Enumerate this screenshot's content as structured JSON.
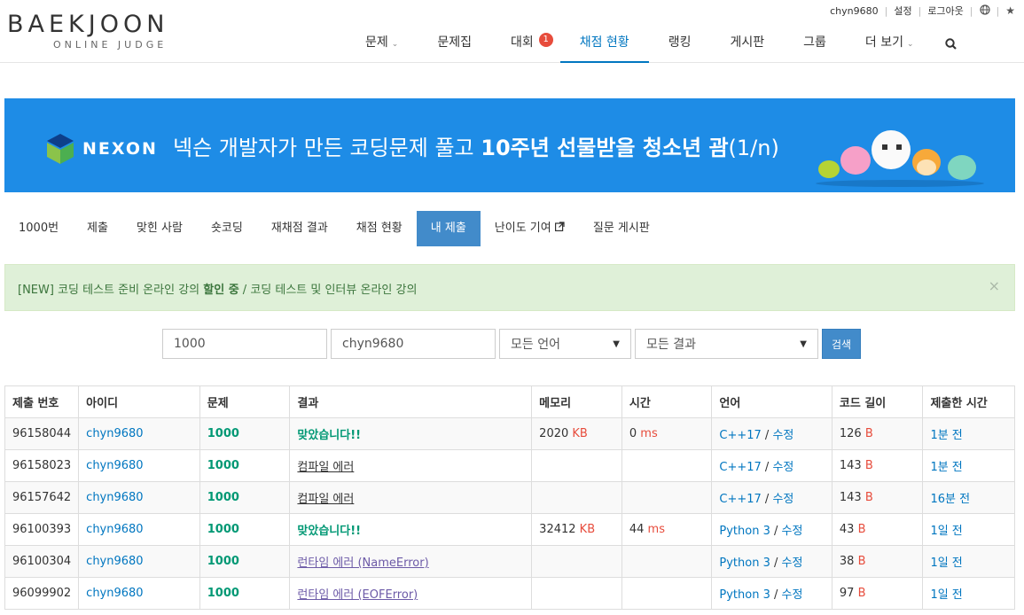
{
  "header": {
    "logo_main": "BAEKJOON",
    "logo_sub": "ONLINE JUDGE",
    "user": "chyn9680",
    "settings": "설정",
    "logout": "로그아웃",
    "nav": [
      {
        "label": "문제",
        "caret": true
      },
      {
        "label": "문제집"
      },
      {
        "label": "대회",
        "badge": "1"
      },
      {
        "label": "채점 현황",
        "active": true
      },
      {
        "label": "랭킹"
      },
      {
        "label": "게시판"
      },
      {
        "label": "그룹"
      },
      {
        "label": "더 보기",
        "caret": true
      }
    ]
  },
  "banner": {
    "brand": "NEXON",
    "text_prefix": "넥슨 개발자가 만든 코딩문제 풀고 ",
    "text_bold": "10주년 선물받을 청소년 괌",
    "text_suffix": "(1/n)"
  },
  "tabs": [
    "1000번",
    "제출",
    "맞힌 사람",
    "숏코딩",
    "재채점 결과",
    "채점 현황",
    "내 제출",
    "난이도 기여",
    "질문 게시판"
  ],
  "alert": {
    "prefix": "[NEW] 코딩 테스트 준비 온라인 강의 ",
    "bold": "할인 중",
    "suffix": " / 코딩 테스트 및 인터뷰 온라인 강의"
  },
  "filter": {
    "problem": "1000",
    "user": "chyn9680",
    "language": "모든 언어",
    "result": "모든 결과",
    "search": "검색"
  },
  "table": {
    "headers": [
      "제출 번호",
      "아이디",
      "문제",
      "결과",
      "메모리",
      "시간",
      "언어",
      "코드 길이",
      "제출한 시간"
    ],
    "rows": [
      {
        "id": "96158044",
        "user": "chyn9680",
        "problem": "1000",
        "result": "맞았습니다!!",
        "result_type": "ac",
        "memory": "2020",
        "memory_unit": "KB",
        "time": "0",
        "time_unit": "ms",
        "lang": "C++17",
        "edit": "수정",
        "length": "126",
        "length_unit": "B",
        "submitted": "1분 전"
      },
      {
        "id": "96158023",
        "user": "chyn9680",
        "problem": "1000",
        "result": "컴파일 에러",
        "result_type": "ce",
        "memory": "",
        "memory_unit": "",
        "time": "",
        "time_unit": "",
        "lang": "C++17",
        "edit": "수정",
        "length": "143",
        "length_unit": "B",
        "submitted": "1분 전"
      },
      {
        "id": "96157642",
        "user": "chyn9680",
        "problem": "1000",
        "result": "컴파일 에러",
        "result_type": "ce",
        "memory": "",
        "memory_unit": "",
        "time": "",
        "time_unit": "",
        "lang": "C++17",
        "edit": "수정",
        "length": "143",
        "length_unit": "B",
        "submitted": "16분 전"
      },
      {
        "id": "96100393",
        "user": "chyn9680",
        "problem": "1000",
        "result": "맞았습니다!!",
        "result_type": "ac",
        "memory": "32412",
        "memory_unit": "KB",
        "time": "44",
        "time_unit": "ms",
        "lang": "Python 3",
        "edit": "수정",
        "length": "43",
        "length_unit": "B",
        "submitted": "1일 전"
      },
      {
        "id": "96100304",
        "user": "chyn9680",
        "problem": "1000",
        "result": "런타임 에러 (NameError)",
        "result_type": "re",
        "memory": "",
        "memory_unit": "",
        "time": "",
        "time_unit": "",
        "lang": "Python 3",
        "edit": "수정",
        "length": "38",
        "length_unit": "B",
        "submitted": "1일 전"
      },
      {
        "id": "96099902",
        "user": "chyn9680",
        "problem": "1000",
        "result": "런타임 에러 (EOFError)",
        "result_type": "re",
        "memory": "",
        "memory_unit": "",
        "time": "",
        "time_unit": "",
        "lang": "Python 3",
        "edit": "수정",
        "length": "97",
        "length_unit": "B",
        "submitted": "1일 전"
      }
    ]
  },
  "colors": {
    "brand_blue": "#0076c0",
    "accepted": "#009874",
    "unit_red": "#e74c3c",
    "banner_blue": "#1e8ce6"
  }
}
